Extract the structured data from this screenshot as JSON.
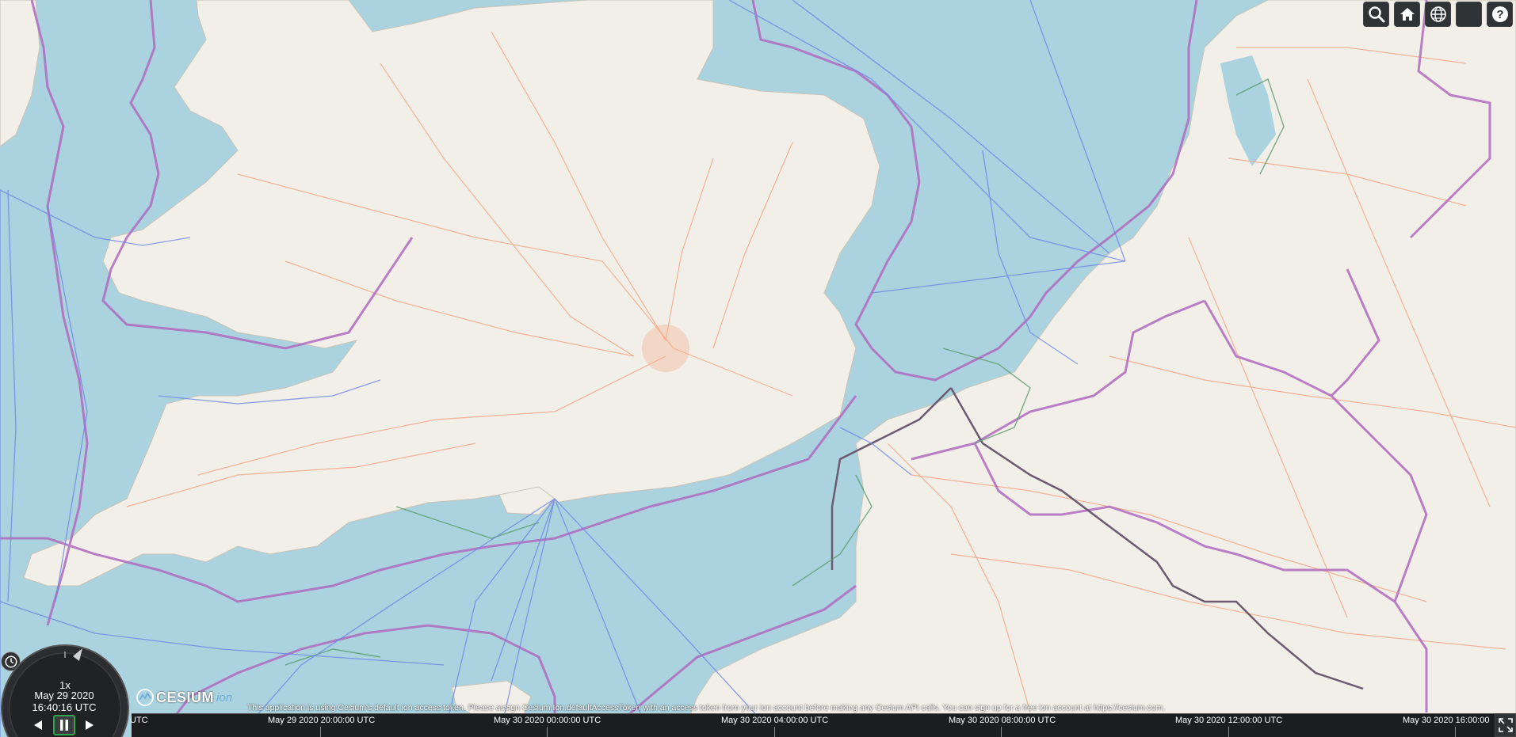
{
  "toolbar": {
    "search_icon": "search-icon",
    "home_icon": "home-icon",
    "scene_mode_icon": "globe-icon",
    "base_layer_icon": "layers-icon",
    "help_icon": "help-icon"
  },
  "animation": {
    "speed": "1x",
    "date": "May 29 2020",
    "time": "16:40:16 UTC"
  },
  "logo": {
    "main": "CESIUM",
    "ion": "ion"
  },
  "credits": {
    "text": "This application is using Cesium's default ion access token. Please assign Cesium.Ion.defaultAccessToken with an access token from your ion account before making any Cesium API calls. You can sign up for a free ion account at https://cesium.com."
  },
  "timeline": {
    "labels": [
      "UTC",
      "May 29 2020 20:00:00 UTC",
      "May 30 2020 00:00:00 UTC",
      "May 30 2020 04:00:00 UTC",
      "May 30 2020 08:00:00 UTC",
      "May 30 2020 12:00:00 UTC",
      "May 30 2020 16:00:00"
    ]
  },
  "colors": {
    "sea": "#aad3df",
    "land": "#f2efe9",
    "roads": "#f4a886",
    "borders": "#b06abf",
    "routes": "#6e86e6",
    "ui_dark": "#303336"
  }
}
